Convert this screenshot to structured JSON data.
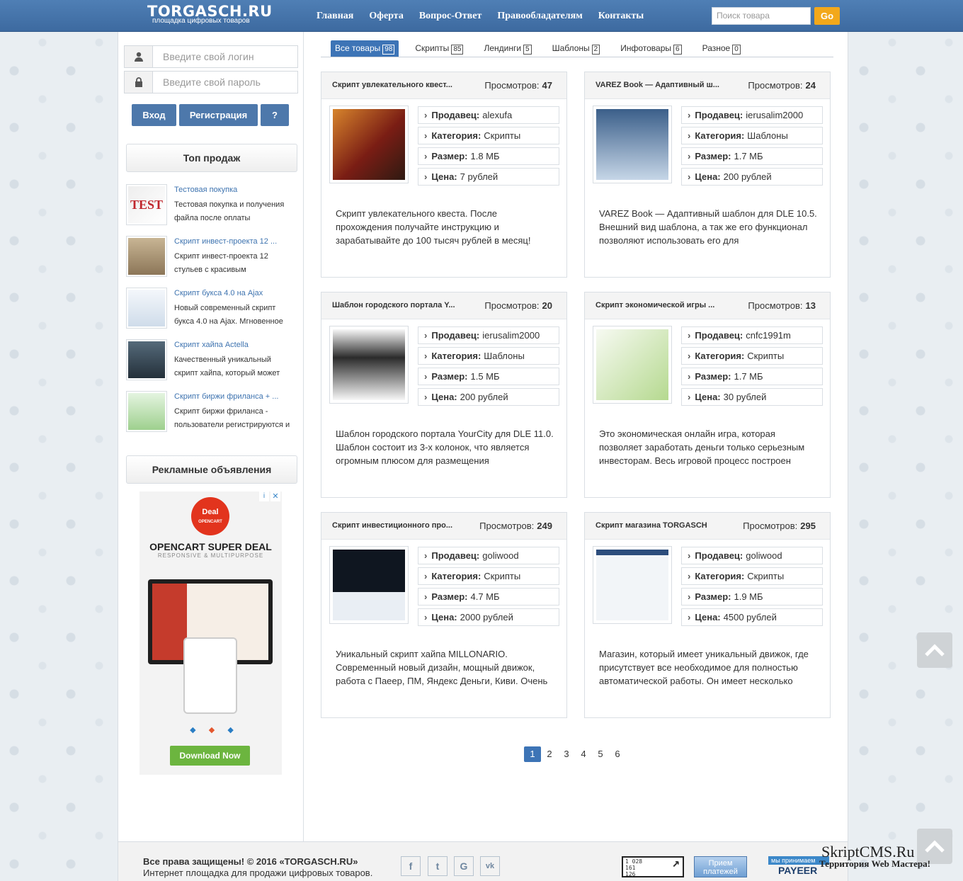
{
  "header": {
    "logo": "TORGASCH.RU",
    "logo_sub": "площадка цифровых товаров",
    "nav": [
      "Главная",
      "Оферта",
      "Вопрос-Ответ",
      "Правообладателям",
      "Контакты"
    ],
    "search_placeholder": "Поиск товара",
    "go_label": "Go"
  },
  "login": {
    "login_placeholder": "Введите свой логин",
    "password_placeholder": "Введите свой пароль",
    "btn_login": "Вход",
    "btn_register": "Регистрация",
    "btn_help": "?"
  },
  "sidebar": {
    "top_title": "Топ продаж",
    "top": [
      {
        "title": "Тестовая покупка",
        "desc": "Тестовая покупка и получения файла после оплаты"
      },
      {
        "title": "Скрипт инвест-проекта 12 ...",
        "desc": "Скрипт инвест-проекта 12 стульев с красивым"
      },
      {
        "title": "Скрипт букса 4.0 на Ajax",
        "desc": "Новый современный скрипт букса 4.0 на Ajax. Мгновенное"
      },
      {
        "title": "Скрипт хайпа Actella",
        "desc": "Качественный уникальный скрипт хайпа, который может"
      },
      {
        "title": "Скрипт биржи фриланса + ...",
        "desc": "Скрипт биржи фриланса - пользователи регистрируются и"
      }
    ],
    "ads_title": "Рекламные объявления",
    "ad": {
      "badge": "Deal",
      "badge_sub": "OPENCART",
      "headline": "OPENCART SUPER DEAL",
      "sub": "RESPONSIVE & MULTIPURPOSE",
      "cta": "Download Now"
    }
  },
  "tabs": [
    {
      "label": "Все товары",
      "count": "98"
    },
    {
      "label": "Скрипты",
      "count": "85"
    },
    {
      "label": "Лендинги",
      "count": "5"
    },
    {
      "label": "Шаблоны",
      "count": "2"
    },
    {
      "label": "Инфотовары",
      "count": "6"
    },
    {
      "label": "Разное",
      "count": "0"
    }
  ],
  "labels": {
    "views": "Просмотров:",
    "seller": "Продавец:",
    "category": "Категория:",
    "size": "Размер:",
    "price": "Цена:"
  },
  "products": [
    {
      "title": "Скрипт увлекательного квест...",
      "views": "47",
      "seller": "alexufa",
      "category": "Скрипты",
      "size": "1.8 МБ",
      "price": "7 рублей",
      "desc": "Скрипт увлекательного квеста. После прохождения получайте инструкцию и зарабатывайте до 100 тысяч рублей в месяц!"
    },
    {
      "title": "VAREZ Book — Адаптивный ш...",
      "views": "24",
      "seller": "ierusalim2000",
      "category": "Шаблоны",
      "size": "1.7 МБ",
      "price": "200 рублей",
      "desc": "VAREZ Book — Адаптивный шаблон для DLE 10.5. Внешний вид шаблона, а так же его функционал позволяют использовать его для"
    },
    {
      "title": "Шаблон городского портала Y...",
      "views": "20",
      "seller": "ierusalim2000",
      "category": "Шаблоны",
      "size": "1.5 МБ",
      "price": "200 рублей",
      "desc": "Шаблон городского портала YourCity для DLE 11.0. Шаблон состоит из 3-х колонок, что является огромным плюсом для размещения"
    },
    {
      "title": "Скрипт экономической игры ...",
      "views": "13",
      "seller": "cnfc1991m",
      "category": "Скрипты",
      "size": "1.7 МБ",
      "price": "30 рублей",
      "desc": "Это экономическая онлайн игра, которая позволяет заработать деньги только серьезным инвесторам. Весь игровой процесс построен"
    },
    {
      "title": "Скрипт инвестиционного про...",
      "views": "249",
      "seller": "goliwood",
      "category": "Скрипты",
      "size": "4.7 МБ",
      "price": "2000 рублей",
      "desc": "Уникальный скрипт хайпа MILLONARIO. Современный новый дизайн, мощный движок, работа с Паеер, ПМ, Яндекс Деньги, Киви. Очень"
    },
    {
      "title": "Скрипт магазина TORGASCH",
      "views": "295",
      "seller": "goliwood",
      "category": "Скрипты",
      "size": "1.9 МБ",
      "price": "4500 рублей",
      "desc": "Магазин, который имеет уникальный движок, где присутствует все необходимое для полностью автоматической работы. Он имеет несколько"
    }
  ],
  "pagination": [
    "1",
    "2",
    "3",
    "4",
    "5",
    "6"
  ],
  "footer": {
    "copyright": "Все права защищены! © 2016 «TORGASCH.RU»",
    "tagline": "Интернет площадка для продажи цифровых товаров.",
    "social": [
      "f",
      "t",
      "G",
      "vk"
    ],
    "counter": "1 028\n161\n126",
    "priem": "Прием платежей",
    "payeer_top": "мы принимаем",
    "payeer": "PAYEER"
  },
  "watermark": {
    "line1": "SkriptCMS.Ru",
    "line2": "Территория Web Мастера!"
  }
}
